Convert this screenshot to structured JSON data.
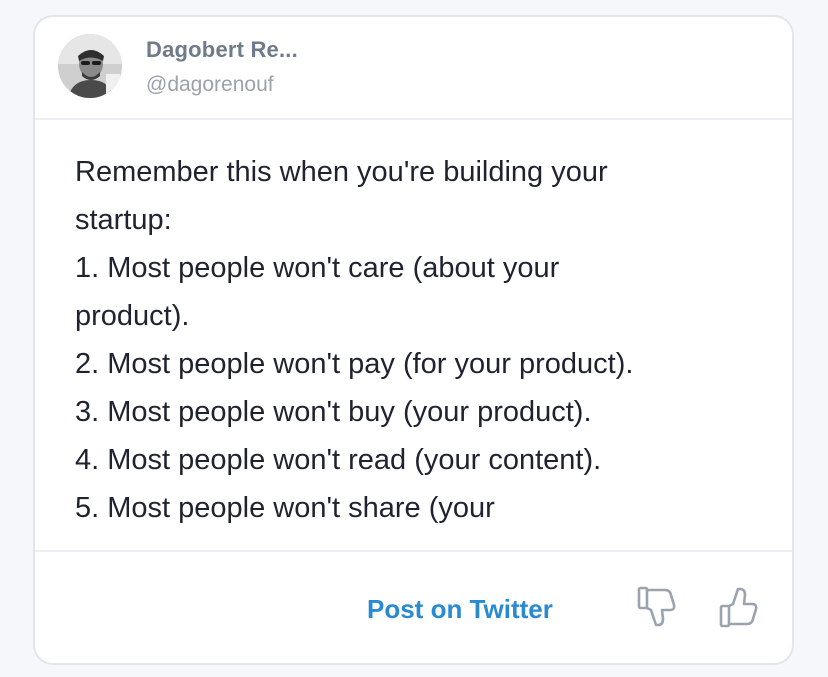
{
  "author": {
    "name": "Dagobert Re...",
    "handle": "@dagorenouf"
  },
  "tweet": {
    "lines": [
      "Remember this when you're building your",
      "startup:",
      "1. Most people won't care (about your",
      "product).",
      "2. Most people won't pay (for your product).",
      "3. Most people won't buy (your product).",
      "4. Most people won't read (your content).",
      "5. Most people won't share (your"
    ]
  },
  "footer": {
    "post_label": "Post on Twitter",
    "dislike_icon": "thumbs-down-icon",
    "like_icon": "thumbs-up-icon"
  },
  "colors": {
    "accent": "#2a8ad1",
    "icon_gray": "#9aa3ae"
  }
}
